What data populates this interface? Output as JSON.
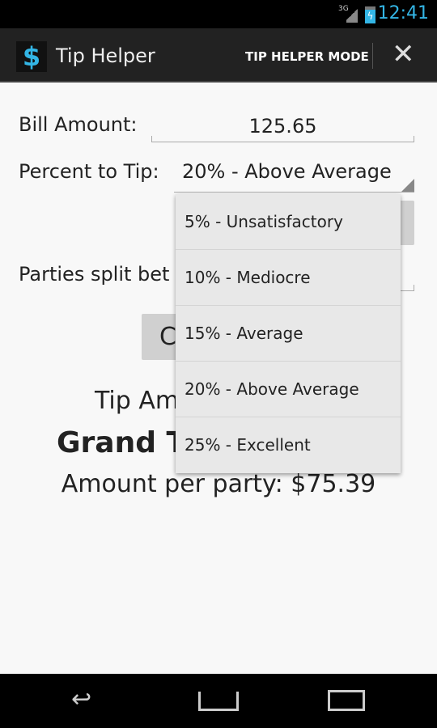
{
  "status": {
    "network": "3G",
    "time": "12:41"
  },
  "action_bar": {
    "title": "Tip Helper",
    "mode_button": "TIP HELPER MODE",
    "logo": "$"
  },
  "form": {
    "bill_label": "Bill Amount:",
    "bill_value": "125.65",
    "percent_label": "Percent to Tip:",
    "percent_value": "20% - Above Average",
    "parties_label": "Parties split bet",
    "calc_button": "C"
  },
  "results": {
    "tip": "Tip Am",
    "grand": "Grand T",
    "per_party": "Amount per party: $75.39"
  },
  "dropdown": {
    "options": [
      "5% - Unsatisfactory",
      "10% - Mediocre",
      "15% - Average",
      "20% - Above Average",
      "25% - Excellent"
    ]
  },
  "colors": {
    "accent": "#33b5e5"
  }
}
